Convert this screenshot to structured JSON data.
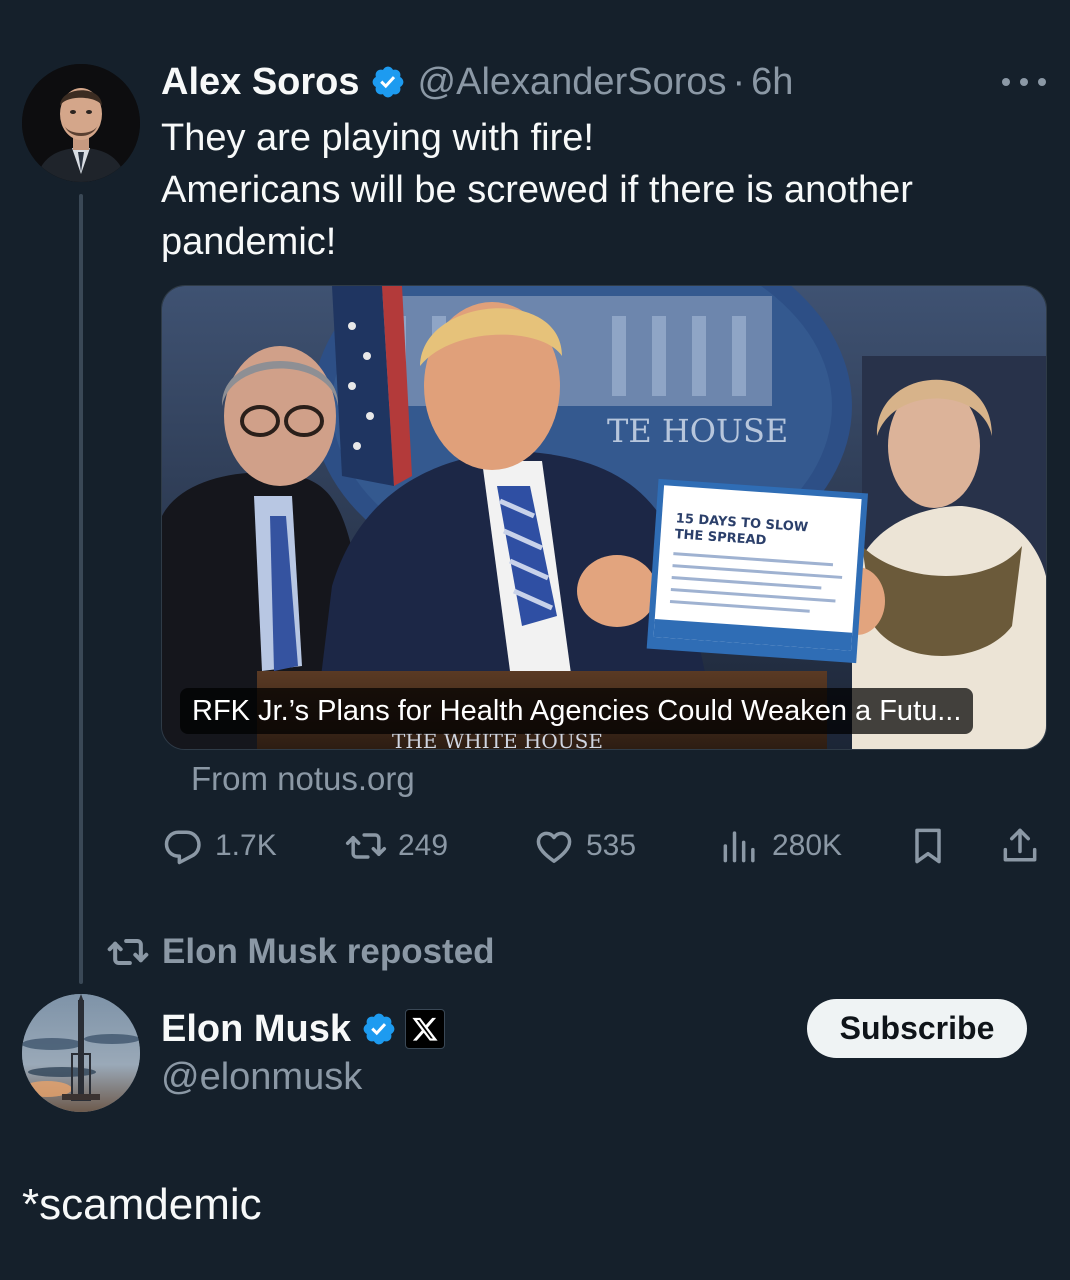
{
  "colors": {
    "background": "#15202b",
    "text_primary": "#f7f9f9",
    "text_secondary": "#8b98a5",
    "verified_blue": "#1d9bf0",
    "subscribe_bg": "#eff3f4"
  },
  "tweet": {
    "author": {
      "name": "Alex Soros",
      "handle": "@AlexanderSoros",
      "separator": "·",
      "time": "6h",
      "verified": true
    },
    "text_lines": [
      "They are playing with fire!",
      "Americans will be screwed if there is another",
      "pandemic!"
    ],
    "card": {
      "caption": "RFK Jr.’s Plans for Health Agencies Could Weaken a Futu...",
      "source": "From notus.org"
    },
    "actions": {
      "replies": "1.7K",
      "reposts": "249",
      "likes": "535",
      "views": "280K"
    },
    "icons": {
      "more": "more-horizontal-icon",
      "reply": "reply-bubble-icon",
      "repost": "repost-arrows-icon",
      "like": "heart-icon",
      "views": "views-bars-icon",
      "bookmark": "bookmark-icon",
      "share": "share-icon"
    }
  },
  "repost_label": "Elon Musk reposted",
  "reposter": {
    "name": "Elon Musk",
    "handle": "@elonmusk",
    "verified": true,
    "affiliation_badge": "x-logo-icon",
    "subscribe_label": "Subscribe"
  },
  "reply": {
    "text": "*scamdemic"
  }
}
